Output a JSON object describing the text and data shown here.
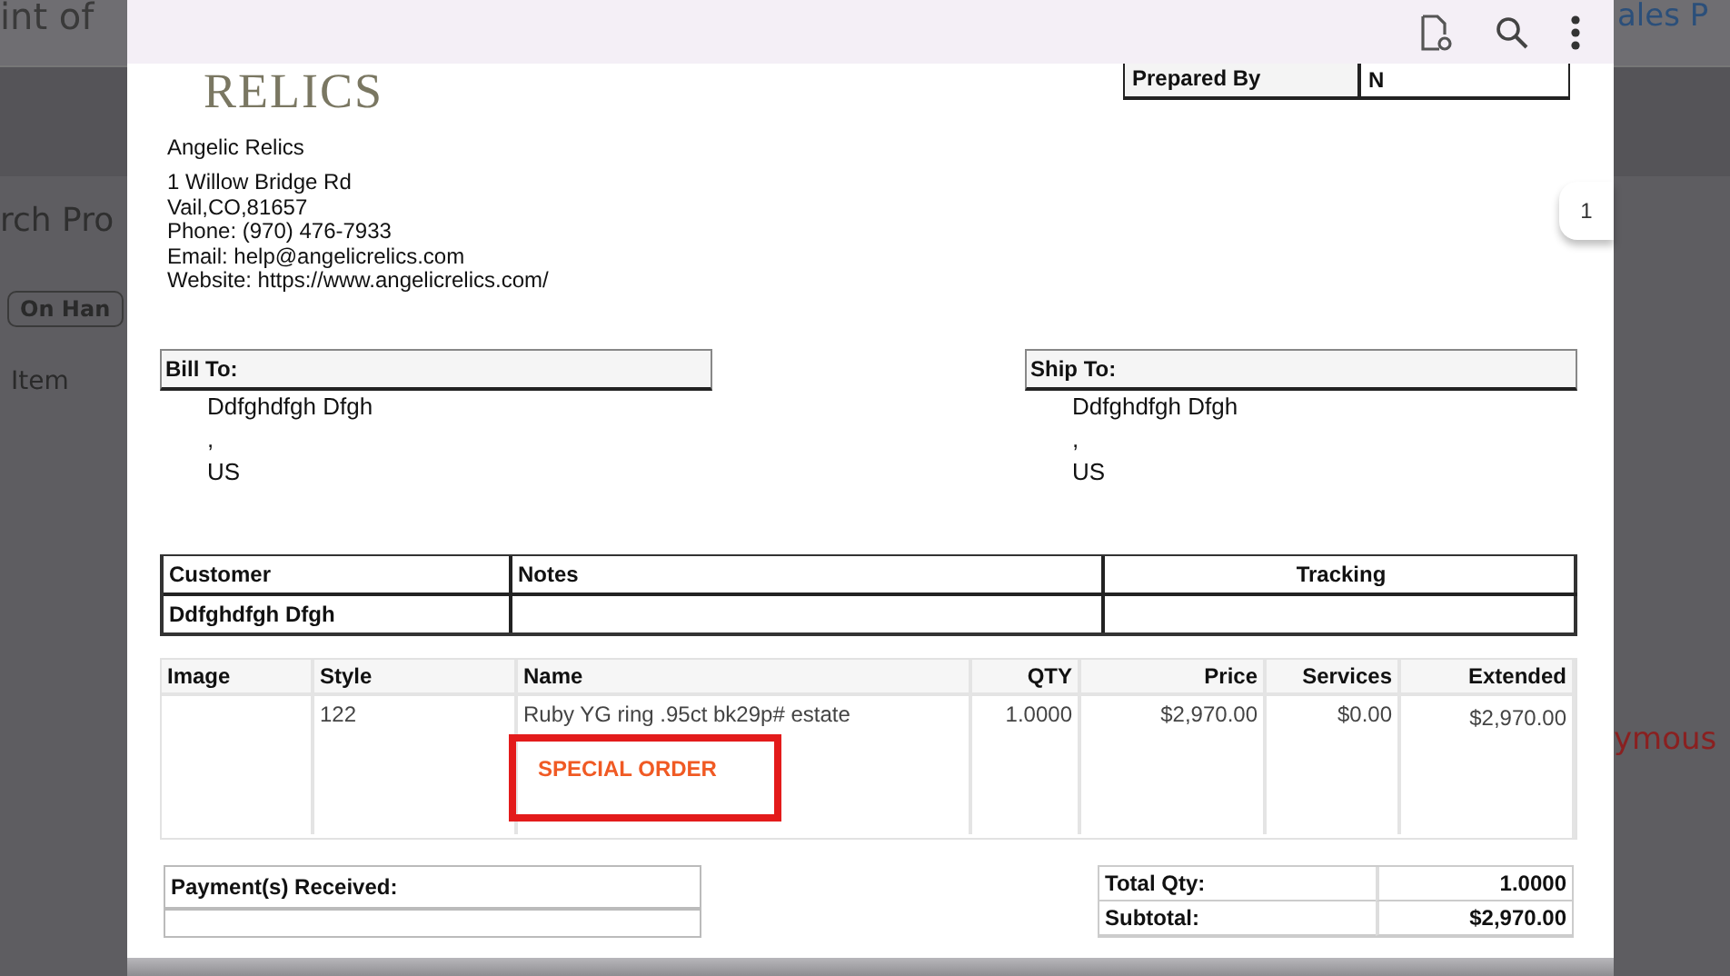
{
  "background_app": {
    "title_fragment": "int of",
    "search_fragment": "rch Pro",
    "filter_button": "On Han",
    "column_header": "Item",
    "right_heading": "ales P",
    "right_text": "ymous"
  },
  "viewer": {
    "page_number": "1",
    "document": {
      "logo": "RELICS",
      "company": {
        "name": "Angelic Relics",
        "lines": [
          "1 Willow Bridge Rd",
          "Vail,CO,81657",
          "Phone: (970) 476-7933",
          "Email: help@angelicrelics.com",
          "Website: https://www.angelicrelics.com/"
        ]
      },
      "prepared_by": {
        "label": "Prepared By",
        "value": "N"
      },
      "bill_to": {
        "heading": "Bill To:",
        "lines": [
          "Ddfghdfgh Dfgh",
          ",",
          "US"
        ]
      },
      "ship_to": {
        "heading": "Ship To:",
        "lines": [
          "Ddfghdfgh Dfgh",
          ",",
          "US"
        ]
      },
      "customer_table": {
        "columns": [
          "Customer",
          "Notes",
          "Tracking"
        ],
        "row": [
          "Ddfghdfgh Dfgh"
        ]
      },
      "items_table": {
        "columns": [
          "Image",
          "Style",
          "Name",
          "QTY",
          "Price",
          "Services",
          "Extended"
        ],
        "rows": [
          {
            "style": "122",
            "name": "Ruby YG ring .95ct bk29p# estate",
            "note": "SPECIAL ORDER",
            "note_outlined": true,
            "qty": "1.0000",
            "price": "$2,970.00",
            "services": "$0.00",
            "extended": "$2,970.00"
          }
        ]
      },
      "payments": {
        "heading": "Payment(s) Received:"
      },
      "totals": [
        {
          "label": "Total Qty:",
          "value": "1.0000"
        },
        {
          "label": "Subtotal:",
          "value": "$2,970.00"
        }
      ]
    }
  }
}
